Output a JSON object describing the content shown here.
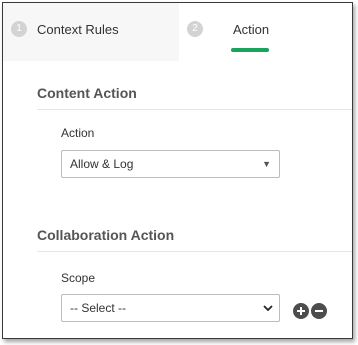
{
  "tabs": [
    {
      "step": "1",
      "label": "Context Rules"
    },
    {
      "step": "2",
      "label": "Action"
    }
  ],
  "content_action": {
    "title": "Content Action",
    "action_label": "Action",
    "action_value": "Allow & Log"
  },
  "collaboration_action": {
    "title": "Collaboration Action",
    "scope_label": "Scope",
    "scope_value": "-- Select --"
  },
  "colors": {
    "active_tab_underline": "#1aa35b",
    "round_button": "#4d4d4d"
  }
}
